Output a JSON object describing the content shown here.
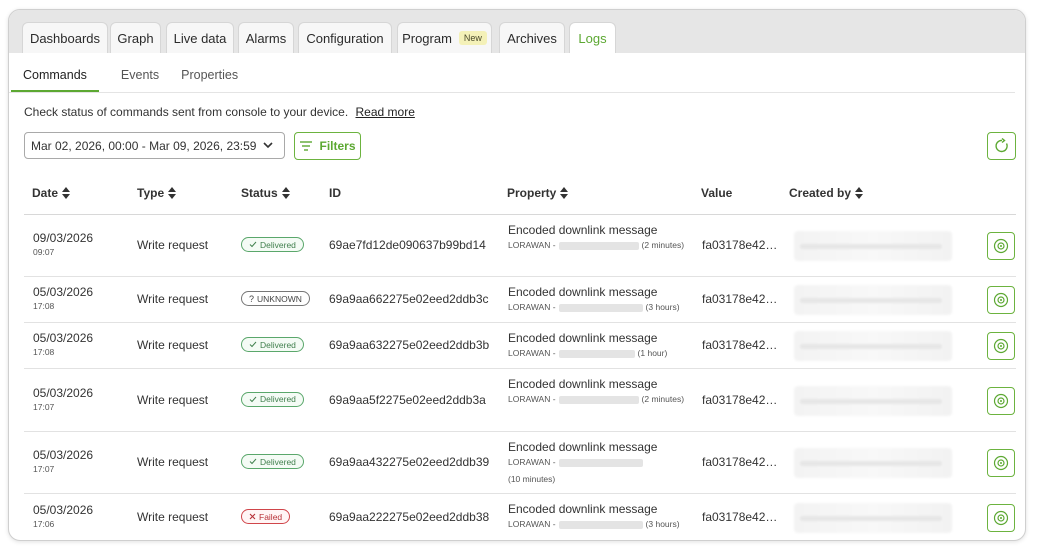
{
  "tabs": [
    {
      "label": "Dashboards"
    },
    {
      "label": "Graph"
    },
    {
      "label": "Live data"
    },
    {
      "label": "Alarms"
    },
    {
      "label": "Configuration"
    },
    {
      "label": "Program",
      "badge": "New"
    },
    {
      "label": "Archives"
    },
    {
      "label": "Logs",
      "active": true
    }
  ],
  "subtabs": [
    {
      "label": "Commands",
      "active": true
    },
    {
      "label": "Events"
    },
    {
      "label": "Properties"
    }
  ],
  "info": {
    "text": "Check status of commands sent from console to your device.",
    "link": "Read more"
  },
  "filters": {
    "date_range": "Mar 02, 2026, 00:00 - Mar 09, 2026, 23:59",
    "filters_label": "Filters"
  },
  "table": {
    "headers": {
      "date": "Date",
      "type": "Type",
      "status": "Status",
      "id": "ID",
      "property": "Property",
      "value": "Value",
      "created_by": "Created by"
    },
    "rows": [
      {
        "date": "09/03/2026",
        "time": "09:07",
        "type": "Write request",
        "status": "Delivered",
        "status_kind": "delivered",
        "id": "69ae7fd12de090637b99bd14",
        "property": "Encoded downlink message",
        "prop_prefix": "LORAWAN -",
        "prop_suffix": "(2 minutes)",
        "value": "fa03178e42…"
      },
      {
        "date": "05/03/2026",
        "time": "17:08",
        "type": "Write request",
        "status": "UNKNOWN",
        "status_kind": "unknown",
        "id": "69a9aa662275e02eed2ddb3c",
        "property": "Encoded downlink message",
        "prop_prefix": "LORAWAN -",
        "prop_suffix": "(3 hours)",
        "value": "fa03178e42…"
      },
      {
        "date": "05/03/2026",
        "time": "17:08",
        "type": "Write request",
        "status": "Delivered",
        "status_kind": "delivered",
        "id": "69a9aa632275e02eed2ddb3b",
        "property": "Encoded downlink message",
        "prop_prefix": "LORAWAN -",
        "prop_suffix": "(1 hour)",
        "value": "fa03178e42…"
      },
      {
        "date": "05/03/2026",
        "time": "17:07",
        "type": "Write request",
        "status": "Delivered",
        "status_kind": "delivered",
        "id": "69a9aa5f2275e02eed2ddb3a",
        "property": "Encoded downlink message",
        "prop_prefix": "LORAWAN -",
        "prop_suffix": "(2 minutes)",
        "value": "fa03178e42…"
      },
      {
        "date": "05/03/2026",
        "time": "17:07",
        "type": "Write request",
        "status": "Delivered",
        "status_kind": "delivered",
        "id": "69a9aa432275e02eed2ddb39",
        "property": "Encoded downlink message",
        "prop_prefix": "LORAWAN -",
        "prop_suffix": "(10 minutes)",
        "value": "fa03178e42…"
      },
      {
        "date": "05/03/2026",
        "time": "17:06",
        "type": "Write request",
        "status": "Failed",
        "status_kind": "failed",
        "id": "69a9aa222275e02eed2ddb38",
        "property": "Encoded downlink message",
        "prop_prefix": "LORAWAN -",
        "prop_suffix": "(3 hours)",
        "value": "fa03178e42…"
      }
    ]
  },
  "colors": {
    "accent": "#5ca832",
    "delivered": "#3f7f4c",
    "failed": "#b73137"
  },
  "icons": {
    "sort": "sort-icon",
    "filter": "filter-icon",
    "refresh": "refresh-icon",
    "view": "eye-icon",
    "dropdown": "chevron-down-icon"
  }
}
